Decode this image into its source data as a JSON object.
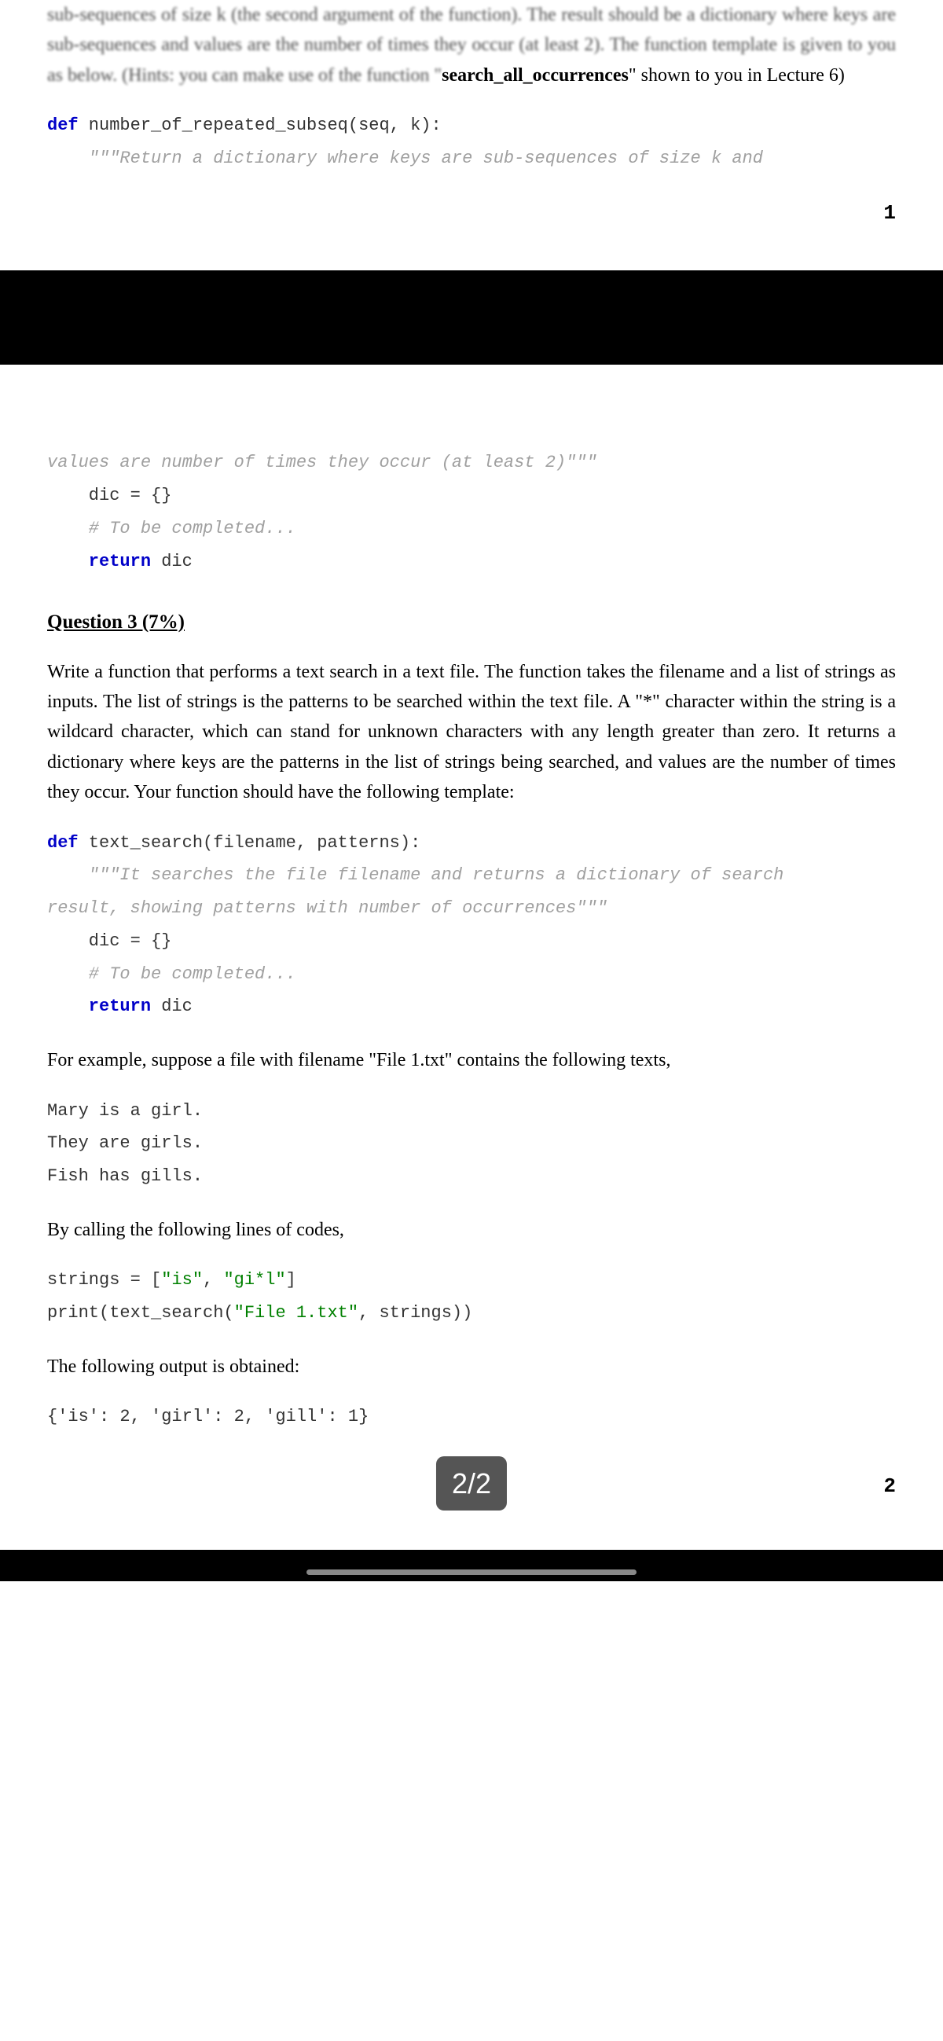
{
  "page1": {
    "intro_partial": "sub-sequences of size k (the second argument of the function). The result should be a dictionary where keys are sub-sequences and values are the number of times they occur (at least 2). The function template is given to you as below. (Hints: you can make use of the function \"",
    "intro_bold": "search_all_occurrences",
    "intro_tail": "\" shown to you in Lecture 6)",
    "code": {
      "def_kw": "def",
      "func_sig": " number_of_repeated_subseq(seq, k):",
      "docstring": "    \"\"\"Return a dictionary where keys are sub-sequences of size k and "
    },
    "page_num": "1"
  },
  "page2": {
    "code_cont": {
      "docstring_end": "values are number of times they occur (at least 2)\"\"\"",
      "dic_line": "    dic = {}",
      "comment": "    # To be completed...",
      "return_kw": "    return",
      "return_val": " dic"
    },
    "q3_heading": "Question 3 (7%)",
    "q3_body": "Write a function that performs a text search in a text file. The function takes the filename and a list of strings as inputs. The list of strings is the patterns to be searched within the text file. A \"*\" character within the string is a wildcard character, which can stand for unknown characters with any length greater than zero. It returns a dictionary where keys are the patterns in the list of strings being searched, and values are the number of times they occur. Your function should have the following template:",
    "q3_code": {
      "def_kw": "def",
      "func_sig": " text_search(filename, patterns):",
      "doc1": "    \"\"\"It searches the file filename and returns a dictionary of search",
      "doc2": "result, showing patterns with number of occurrences\"\"\"",
      "dic_line": "    dic = {}",
      "comment": "    # To be completed...",
      "return_kw": "    return",
      "return_val": " dic"
    },
    "example_intro": "For example, suppose a file with filename \"File 1.txt\" contains the following texts,",
    "file_contents": "Mary is a girl.\nThey are girls.\nFish has gills.",
    "calling_intro": "By calling the following lines of codes,",
    "call_code": {
      "line1_a": "strings = [",
      "line1_s1": "\"is\"",
      "line1_b": ", ",
      "line1_s2": "\"gi*l\"",
      "line1_c": "]",
      "line2_a": "print(text_search(",
      "line2_s": "\"File 1.txt\"",
      "line2_b": ", strings))"
    },
    "output_intro": "The following output is obtained:",
    "output": "{'is': 2, 'girl': 2, 'gill': 1}",
    "page_num": "2",
    "page_indicator": "2/2"
  }
}
